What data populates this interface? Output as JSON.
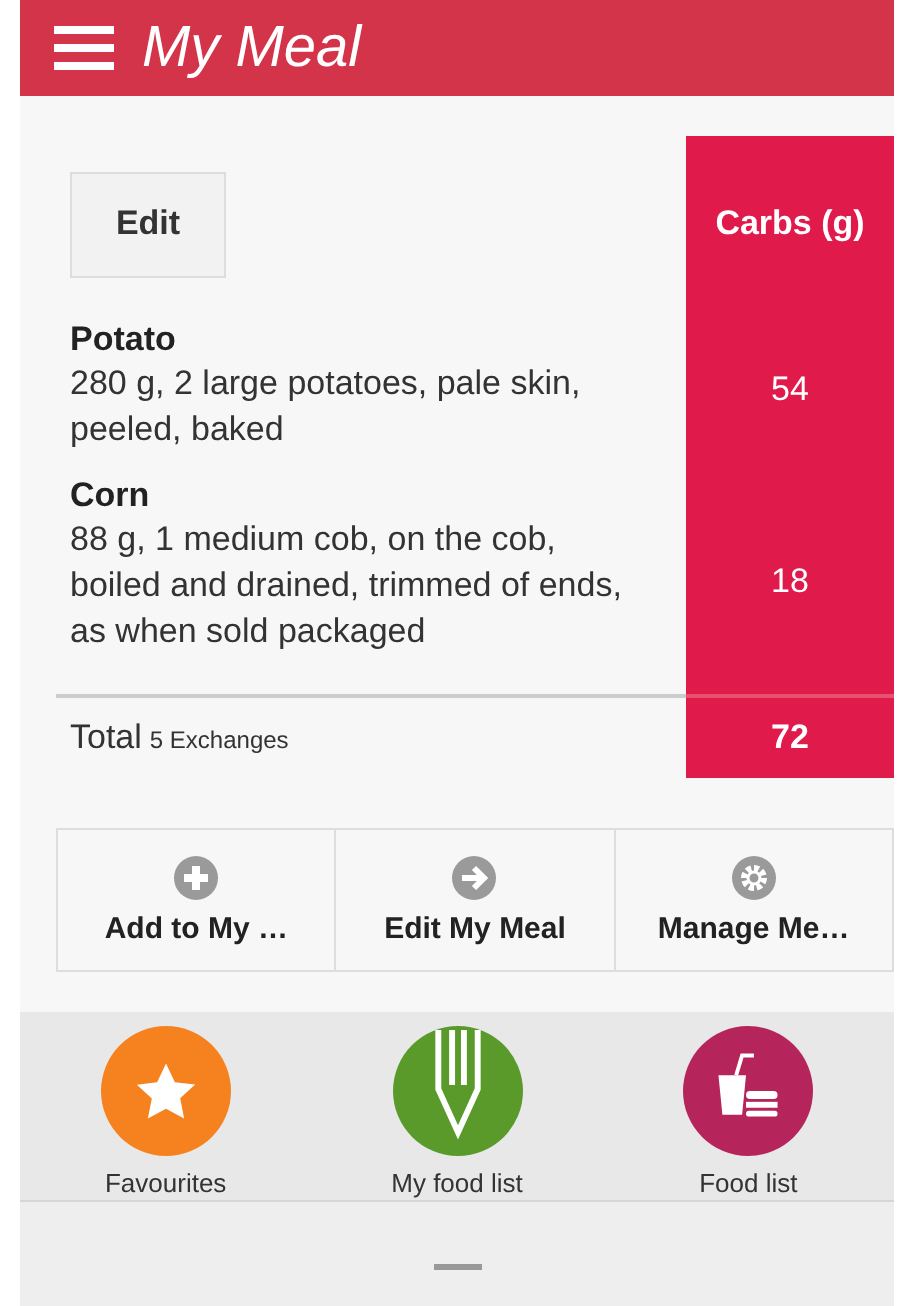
{
  "header": {
    "title": "My Meal"
  },
  "table": {
    "edit_button": "Edit",
    "column": "Carbs (g)",
    "rows": [
      {
        "name": "Potato",
        "description": "280 g, 2 large potatoes, pale skin, peeled, baked",
        "value": "54"
      },
      {
        "name": "Corn",
        "description": "88 g, 1 medium cob, on the cob, boiled and drained, trimmed of ends, as when sold packaged",
        "value": "18"
      }
    ],
    "total": {
      "label": "Total",
      "note": "5 Exchanges",
      "value": "72"
    }
  },
  "actions": [
    {
      "label": "Add to My …",
      "kind": "plus"
    },
    {
      "label": "Edit My Meal",
      "kind": "arrow"
    },
    {
      "label": "Manage Me…",
      "kind": "gear"
    }
  ],
  "nav": [
    {
      "label": "Favourites",
      "kind": "star",
      "color": "#f5821f"
    },
    {
      "label": "My food list",
      "kind": "pencil",
      "color": "#5a9a2a"
    },
    {
      "label": "Food list",
      "kind": "food",
      "color": "#b5245a"
    }
  ]
}
